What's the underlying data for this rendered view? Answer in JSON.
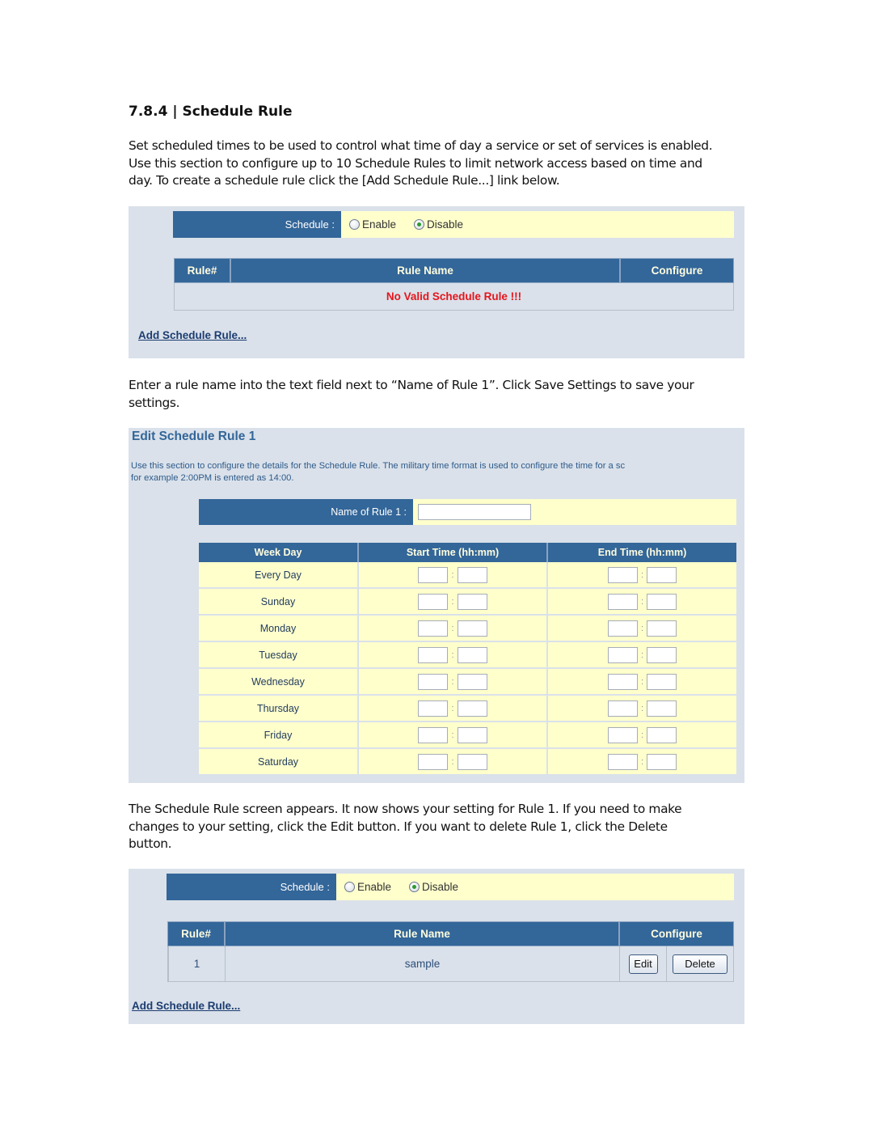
{
  "heading": "7.8.4 | Schedule Rule",
  "intro_paragraph": [
    "Set scheduled times to be used to control what time of day a service or set of services is enabled.",
    "Use this section to configure up to 10 Schedule Rules to limit network access based on time and",
    "day. To create a schedule rule click the [Add Schedule Rule...] link below."
  ],
  "screenshot1": {
    "schedule_label": "Schedule :",
    "radio_enable": "Enable",
    "radio_disable": "Disable",
    "selected": "Disable",
    "columns": [
      "Rule#",
      "Rule Name",
      "Configure"
    ],
    "empty_message": "No Valid Schedule Rule !!!",
    "add_link": "Add Schedule Rule..."
  },
  "middle_paragraph": [
    "Enter a rule name into the text field next to “Name of Rule 1”. Click Save Settings to save your",
    "settings."
  ],
  "screenshot2": {
    "title": "Edit Schedule Rule 1",
    "description": [
      "Use this section to configure the details for the Schedule Rule. The military time format is used to configure the time for a sc",
      "for example 2:00PM is entered as 14:00."
    ],
    "name_label": "Name of Rule 1 :",
    "name_value": "",
    "columns": [
      "Week Day",
      "Start Time (hh:mm)",
      "End Time (hh:mm)"
    ],
    "time_separator": ":",
    "days": [
      "Every Day",
      "Sunday",
      "Monday",
      "Tuesday",
      "Wednesday",
      "Thursday",
      "Friday",
      "Saturday"
    ]
  },
  "final_paragraph": [
    "The Schedule Rule screen appears. It now shows your setting for Rule 1. If you need to make",
    "changes to your setting, click the Edit button. If you want to delete Rule 1, click the Delete",
    "button."
  ],
  "screenshot3": {
    "schedule_label": "Schedule :",
    "radio_enable": "Enable",
    "radio_disable": "Disable",
    "selected": "Disable",
    "columns": [
      "Rule#",
      "Rule Name",
      "Configure"
    ],
    "rows": [
      {
        "rule_no": "1",
        "rule_name": "sample",
        "edit_label": "Edit",
        "delete_label": "Delete"
      }
    ],
    "add_link": "Add Schedule Rule..."
  },
  "colors": {
    "header_blue": "#336699",
    "panel_bg": "#dae1ea",
    "row_yellow": "#ffffcc",
    "error_red": "#e8141b"
  }
}
